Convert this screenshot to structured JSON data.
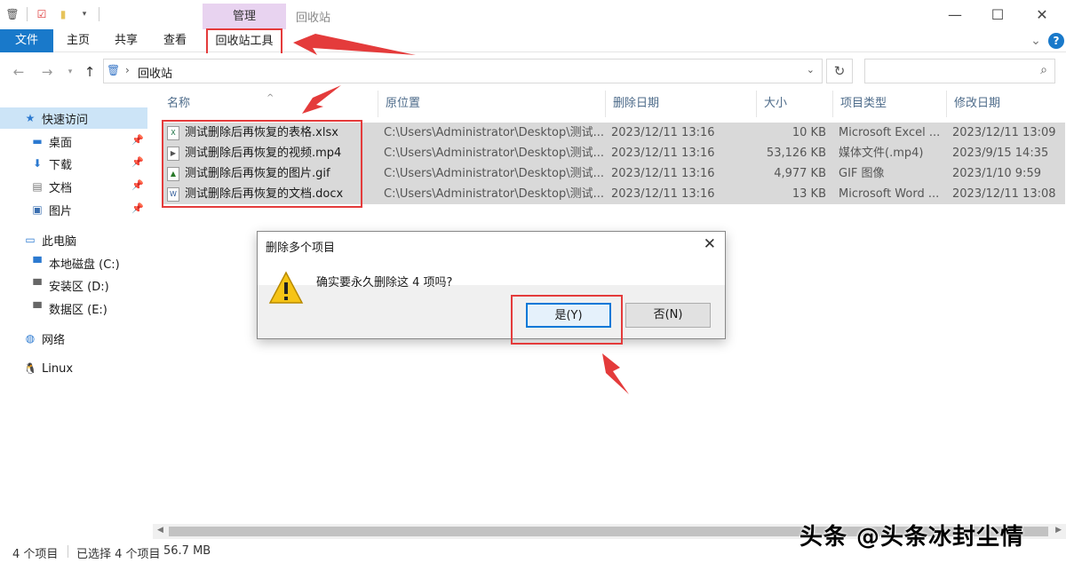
{
  "window": {
    "context_tab": "管理",
    "title": "回收站",
    "minimize_glyph": "—",
    "maximize_glyph": "☐",
    "close_glyph": "✕"
  },
  "ribbon": {
    "tabs": [
      "文件",
      "主页",
      "共享",
      "查看",
      "回收站工具"
    ],
    "expand_glyph": "⌄",
    "help_glyph": "?"
  },
  "address": {
    "back_glyph": "←",
    "forward_glyph": "→",
    "up_glyph": "↑",
    "path": "回收站",
    "search_placeholder": ""
  },
  "sidebar": {
    "items": [
      {
        "label": "快速访问",
        "icon": "star-icon",
        "pinned": false,
        "selected": true
      },
      {
        "label": "桌面",
        "icon": "desktop-icon",
        "pinned": true
      },
      {
        "label": "下载",
        "icon": "download-icon",
        "pinned": true
      },
      {
        "label": "文档",
        "icon": "document-icon",
        "pinned": true
      },
      {
        "label": "图片",
        "icon": "picture-icon",
        "pinned": true
      },
      {
        "label": "此电脑",
        "icon": "computer-icon",
        "pinned": false
      },
      {
        "label": "本地磁盘 (C:)",
        "icon": "drive-icon",
        "pinned": false
      },
      {
        "label": "安装区 (D:)",
        "icon": "drive-icon",
        "pinned": false
      },
      {
        "label": "数据区 (E:)",
        "icon": "drive-icon",
        "pinned": false
      },
      {
        "label": "网络",
        "icon": "network-icon",
        "pinned": false
      },
      {
        "label": "Linux",
        "icon": "linux-icon",
        "pinned": false
      }
    ]
  },
  "list": {
    "columns": [
      "名称",
      "原位置",
      "删除日期",
      "大小",
      "项目类型",
      "修改日期"
    ],
    "rows": [
      {
        "name": "测试删除后再恢复的表格.xlsx",
        "location": "C:\\Users\\Administrator\\Desktop\\测试...",
        "deleted": "2023/12/11 13:16",
        "size": "10 KB",
        "type": "Microsoft Excel ...",
        "modified": "2023/12/11 13:09",
        "icon": "excel-file-icon"
      },
      {
        "name": "测试删除后再恢复的视频.mp4",
        "location": "C:\\Users\\Administrator\\Desktop\\测试...",
        "deleted": "2023/12/11 13:16",
        "size": "53,126 KB",
        "type": "媒体文件(.mp4)",
        "modified": "2023/9/15 14:35",
        "icon": "video-file-icon"
      },
      {
        "name": "测试删除后再恢复的图片.gif",
        "location": "C:\\Users\\Administrator\\Desktop\\测试...",
        "deleted": "2023/12/11 13:16",
        "size": "4,977 KB",
        "type": "GIF 图像",
        "modified": "2023/1/10 9:59",
        "icon": "image-file-icon"
      },
      {
        "name": "测试删除后再恢复的文档.docx",
        "location": "C:\\Users\\Administrator\\Desktop\\测试...",
        "deleted": "2023/12/11 13:16",
        "size": "13 KB",
        "type": "Microsoft Word ...",
        "modified": "2023/12/11 13:08",
        "icon": "word-file-icon"
      }
    ]
  },
  "status": {
    "count": "4 个项目",
    "selected": "已选择 4 个项目",
    "size": "56.7 MB"
  },
  "dialog": {
    "title": "删除多个项目",
    "message": "确实要永久删除这 4 项吗?",
    "yes_label": "是(Y)",
    "no_label": "否(N)",
    "close_glyph": "✕"
  },
  "watermark": "头条 @头条冰封尘情",
  "colors": {
    "accent": "#1979ca",
    "highlight_red": "#e43b3b",
    "context_tab": "#e8d3f0",
    "selection": "#d9d9d9"
  }
}
